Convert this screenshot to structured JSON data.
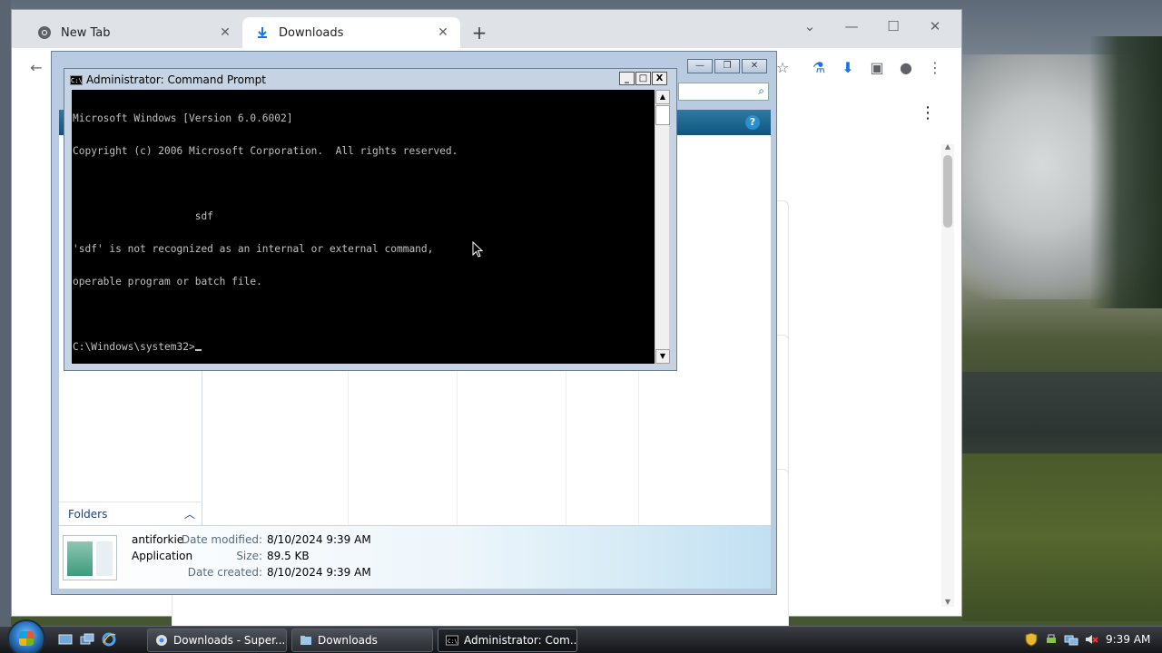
{
  "browser": {
    "tabs": [
      {
        "title": "New Tab",
        "icon": "chrome-icon"
      },
      {
        "title": "Downloads",
        "icon": "download-icon"
      }
    ],
    "new_tab": "+",
    "controls": {
      "minimize": "—",
      "maximize": "☐",
      "close": "✕",
      "tab_search": "⌄"
    },
    "toolbar": {
      "back": "←",
      "bookmark": "☆",
      "labs": "⚗",
      "downloads": "⬇",
      "sidepanel": "▣",
      "profile": "●",
      "menu": "⋮"
    },
    "page_menu": "⋮"
  },
  "explorer": {
    "folders_label": "Folders",
    "help": "?",
    "search_icon": "⌕",
    "file": {
      "name": "antiforkie",
      "type": "Application",
      "date_modified_label": "Date modified:",
      "date_modified": "8/10/2024 9:39 AM",
      "size_label": "Size:",
      "size": "89.5 KB",
      "date_created_label": "Date created:",
      "date_created": "8/10/2024 9:39 AM"
    }
  },
  "cmd": {
    "title": "Administrator: Command Prompt",
    "icon_text": "C:\\",
    "lines": [
      "Microsoft Windows [Version 6.0.6002]",
      "Copyright (c) 2006 Microsoft Corporation.  All rights reserved.",
      "",
      "                    sdf",
      "'sdf' is not recognized as an internal or external command,",
      "operable program or batch file.",
      "",
      "C:\\Windows\\system32>"
    ],
    "controls": {
      "minimize": "_",
      "maximize": "□",
      "close": "X"
    }
  },
  "taskbar": {
    "buttons": [
      {
        "label": "Downloads - Super...",
        "icon": "chrome-icon"
      },
      {
        "label": "Downloads",
        "icon": "folder-icon"
      },
      {
        "label": "Administrator: Com...",
        "icon": "cmd-icon"
      }
    ],
    "clock": "9:39 AM"
  }
}
